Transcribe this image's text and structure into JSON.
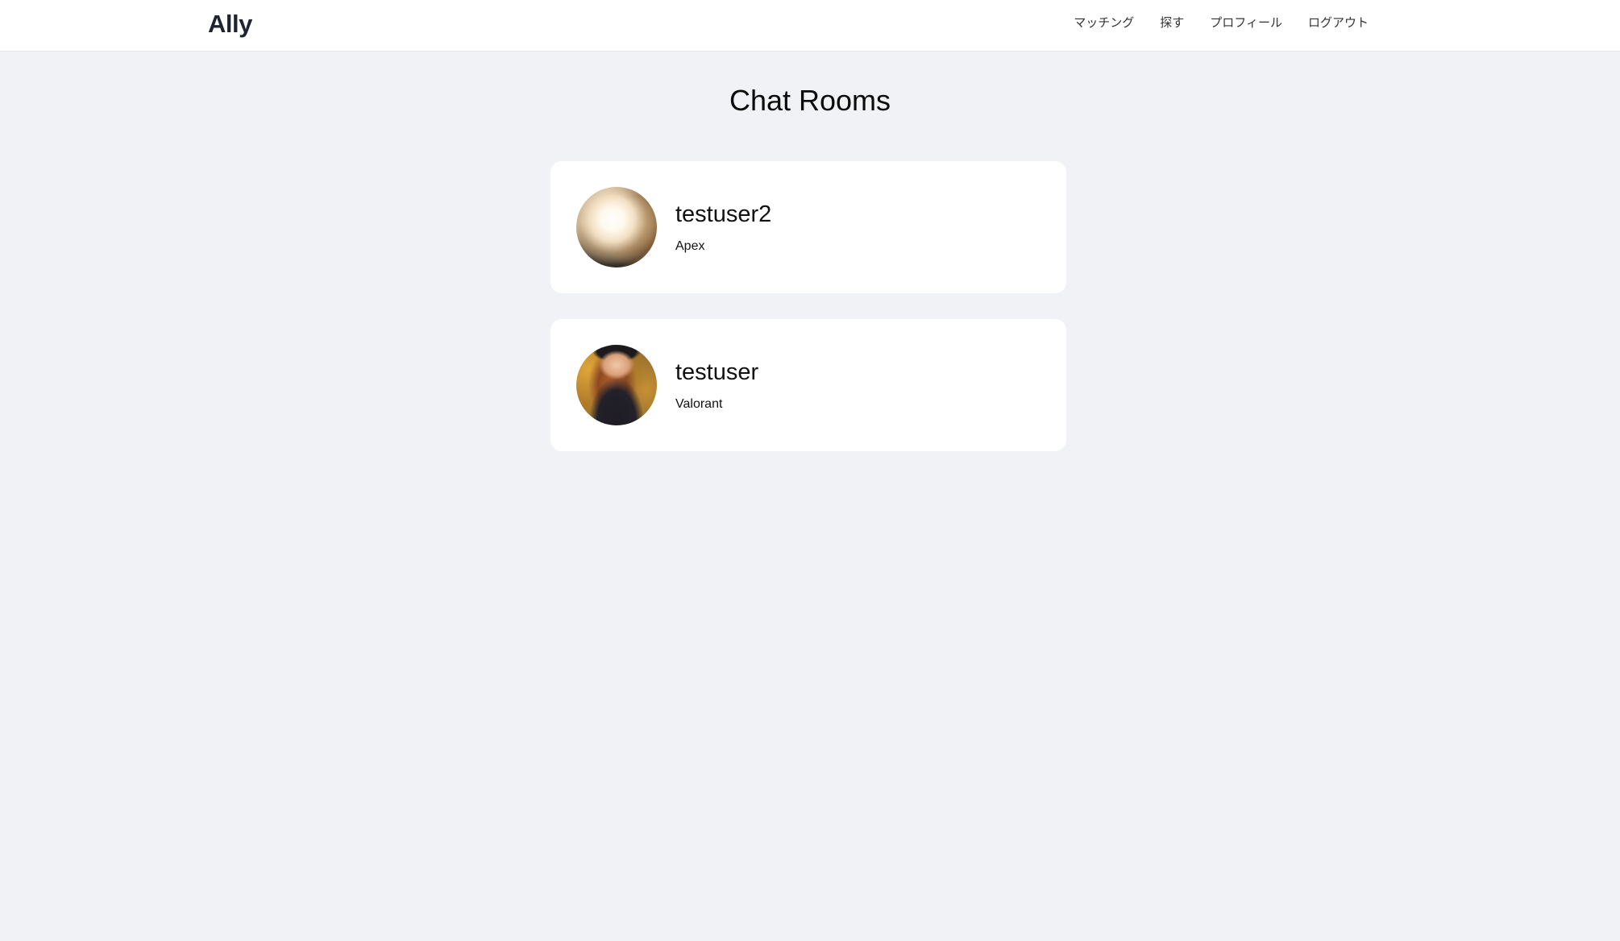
{
  "app": {
    "brand": "Ally"
  },
  "nav": {
    "items": [
      {
        "label": "マッチング"
      },
      {
        "label": "探す"
      },
      {
        "label": "プロフィール"
      },
      {
        "label": "ログアウト"
      }
    ]
  },
  "main": {
    "title": "Chat Rooms",
    "rooms": [
      {
        "username": "testuser2",
        "game": "Apex"
      },
      {
        "username": "testuser",
        "game": "Valorant"
      }
    ]
  },
  "colors": {
    "background": "#f0f2f5",
    "card": "#ffffff",
    "brand_text": "#1f2430"
  }
}
